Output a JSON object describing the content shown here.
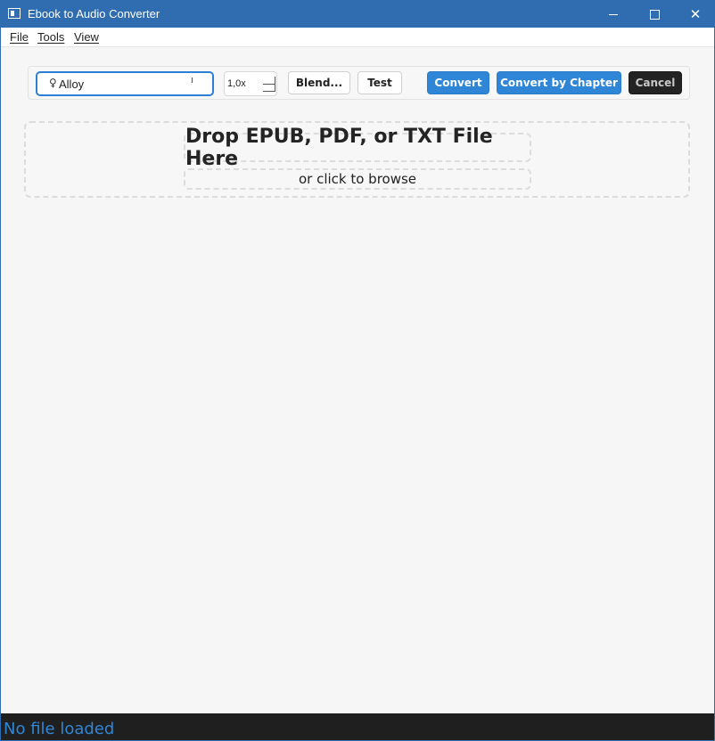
{
  "window": {
    "title": "Ebook to Audio Converter",
    "controls": {
      "minimize": "—",
      "maximize": "□",
      "close": "✕"
    }
  },
  "menubar": {
    "items": [
      {
        "label": "File"
      },
      {
        "label": "Tools"
      },
      {
        "label": "View"
      }
    ]
  },
  "toolbar": {
    "voice": {
      "icon": "female-icon",
      "glyph": "♀",
      "value": "Alloy"
    },
    "speed": {
      "value": "1,0x"
    },
    "blend_label": "Blend...",
    "test_label": "Test",
    "convert_label": "Convert",
    "convert_by_chapter_label": "Convert by Chapter",
    "cancel_label": "Cancel"
  },
  "dropzone": {
    "title": "Drop EPUB, PDF, or TXT File Here",
    "subtitle": "or click to browse"
  },
  "statusbar": {
    "text": "No file loaded"
  },
  "colors": {
    "titlebar": "#2f6cb0",
    "accent": "#2f86d7",
    "cancel_bg": "#232323",
    "status_bg": "#1f1f1f"
  }
}
